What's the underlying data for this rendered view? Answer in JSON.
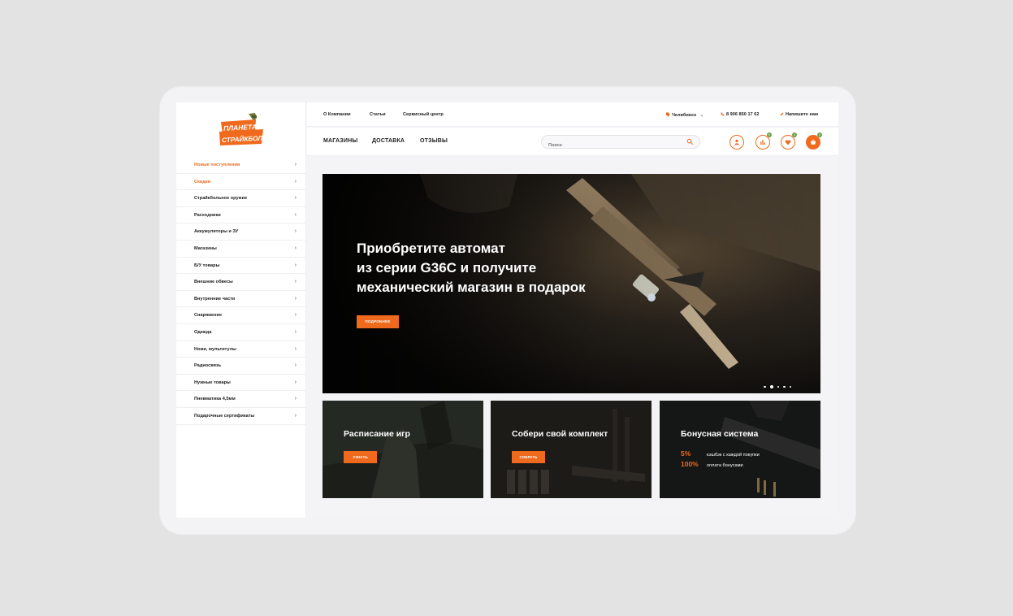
{
  "brand": {
    "logo_line1": "ПЛАНЕТА",
    "logo_line2": "СТРАЙКБОЛА",
    "accent": "#ef6a1c"
  },
  "sidebar": {
    "items": [
      {
        "label": "Новые поступления",
        "active": true
      },
      {
        "label": "Скидки",
        "active": true
      },
      {
        "label": "Страйкбольное оружие"
      },
      {
        "label": "Расходники"
      },
      {
        "label": "Аккумуляторы и ЗУ"
      },
      {
        "label": "Магазины"
      },
      {
        "label": "Б/У товары"
      },
      {
        "label": "Внешние обвесы"
      },
      {
        "label": "Внутренние части"
      },
      {
        "label": "Снаряжение"
      },
      {
        "label": "Одежда"
      },
      {
        "label": "Ножи, мультитулы"
      },
      {
        "label": "Радиосвязь"
      },
      {
        "label": "Нужные товары"
      },
      {
        "label": "Пневматика 4,5мм"
      },
      {
        "label": "Подарочные сертификаты"
      }
    ],
    "chevron": "›"
  },
  "topbar": {
    "links": [
      "О Компании",
      "Статьи",
      "Сервисный центр"
    ],
    "city": "Челябинск",
    "city_chevron": "⌄",
    "phone": "8 906 850 17 62",
    "write": "Напишите нам"
  },
  "navbar": {
    "links": [
      "МАГАЗИНЫ",
      "ДОСТАВКА",
      "ОТЗЫВЫ"
    ],
    "search_placeholder": "Поиск",
    "icons": [
      {
        "name": "user-icon",
        "badge": ""
      },
      {
        "name": "compare-icon",
        "badge": "0"
      },
      {
        "name": "heart-icon",
        "badge": "0"
      },
      {
        "name": "cart-icon",
        "badge": "0"
      }
    ]
  },
  "hero": {
    "title_lines": [
      "Приобретите автомат",
      "из серии G36C и получите",
      "механический магазин в подарок"
    ],
    "button": "ПОДРОБНЕЕ",
    "slides": 5,
    "active_slide": 2
  },
  "cards": [
    {
      "title": "Расписание игр",
      "button": "УЗНАТЬ"
    },
    {
      "title": "Собери свой комплект",
      "button": "СОБРАТЬ"
    },
    {
      "title": "Бонусная система",
      "rows": [
        {
          "value": "5%",
          "text": "кэшбэк с каждой покупки"
        },
        {
          "value": "100%",
          "text": "оплата бонусами"
        }
      ]
    }
  ]
}
